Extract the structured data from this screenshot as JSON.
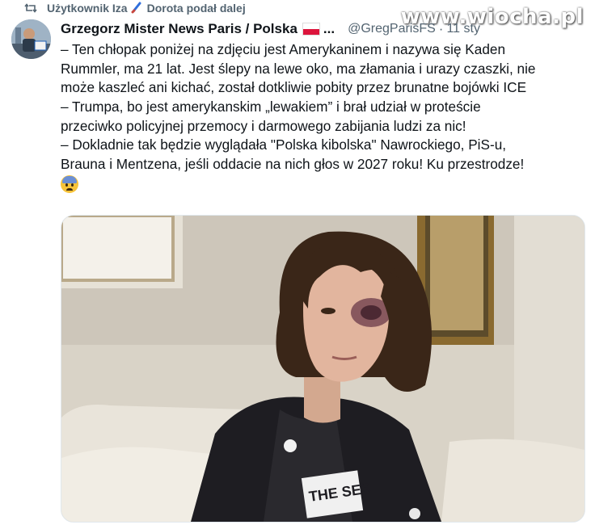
{
  "repost": {
    "user": "Użytkownik Iza",
    "pen_icon": "paintbrush-icon",
    "reposter": "Dorota podał dalej"
  },
  "watermark": "www.wiocha.pl",
  "author": {
    "display_name": "Grzegorz Mister News Paris / Polska",
    "flag": "poland-flag-icon",
    "ellipsis": "...",
    "handle": "@GregParisFS",
    "date": "11 sty",
    "avatar_alt": "avatar"
  },
  "tweet": {
    "lines": [
      "– Ten chłopak poniżej na zdjęciu jest Amerykaninem i nazywa się Kaden",
      "Rummler, ma 21 lat. Jest ślepy na lewe oko, ma złamania i urazy czaszki, nie",
      "może kaszleć ani kichać, został dotkliwie pobity przez brunatne bojówki ICE",
      "– Trumpa, bo jest amerykanskim „lewakiem” i brał udział w proteście",
      "przeciwko policyjnej przemocy i darmowego zabijania ludzi za nic!",
      "– Dokladnie tak będzie wyglądała \"Polska kibolska\" Nawrockiego, PiS-u,",
      "Brauna i Mentzena, jeśli oddacie na nich głos w 2027 roku! Ku przestrodze!"
    ],
    "emoji": "anxious-face-icon"
  },
  "media": {
    "description_icon": "photo-icon",
    "shirt_text": "THE SES"
  },
  "colors": {
    "text": "#0f1419",
    "muted": "#536471",
    "brush": "#2f6fdc",
    "flag_red": "#dc143c"
  }
}
